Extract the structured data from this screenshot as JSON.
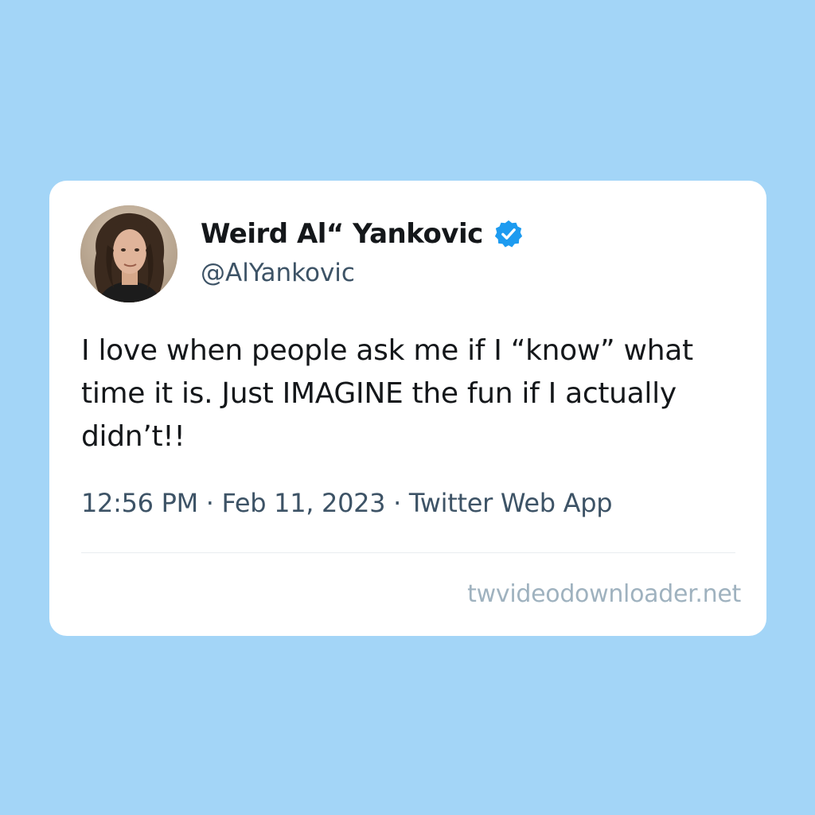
{
  "tweet": {
    "author": {
      "display_name": "Weird Al“ Yankovic",
      "handle": "@AlYankovic",
      "verified": true,
      "avatar_icon": "profile-photo"
    },
    "text": "I love when people ask me if I “know” what time it is. Just IMAGINE the fun if I actually didn’t!!",
    "meta": "12:56 PM · Feb 11, 2023 · Twitter Web App"
  },
  "watermark": "twvideodownloader.net",
  "colors": {
    "background": "#a3d5f7",
    "card": "#ffffff",
    "verified_badge": "#1d9bf0",
    "text_primary": "#14171a",
    "text_secondary": "#3d5366",
    "watermark": "#9fb2bf"
  }
}
